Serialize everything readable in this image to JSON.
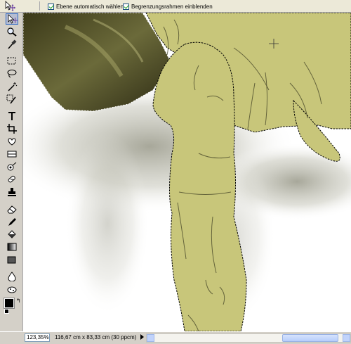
{
  "options_bar": {
    "tool_icon": "move-tool-icon",
    "auto_select_label": "Ebene automatisch wählen",
    "auto_select_checked": true,
    "bounding_box_label": "Begrenzungsrahmen einblenden",
    "bounding_box_checked": true
  },
  "toolbox": {
    "tools": [
      "move-tool-icon",
      "zoom-tool-icon",
      "eyedropper-tool-icon",
      "marquee-tool-icon",
      "lasso-tool-icon",
      "magic-wand-tool-icon",
      "selection-brush-tool-icon",
      "type-tool-icon",
      "crop-tool-icon",
      "cookie-cutter-tool-icon",
      "straighten-tool-icon",
      "red-eye-tool-icon",
      "healing-brush-tool-icon",
      "clone-stamp-tool-icon",
      "eraser-tool-icon",
      "pencil-tool-icon",
      "paint-bucket-tool-icon",
      "gradient-tool-icon",
      "shape-tool-icon",
      "blur-tool-icon",
      "sponge-tool-icon"
    ],
    "foreground_color": "#000000",
    "background_color": "#ffffff"
  },
  "colors": {
    "skin": "#c8c67a",
    "shadow": "#2d2b14",
    "ui_bg": "#d4d0c8"
  },
  "status_bar": {
    "zoom": "123,35%",
    "doc_info": "116,67 cm x 83,33 cm (30 ppcm)"
  }
}
